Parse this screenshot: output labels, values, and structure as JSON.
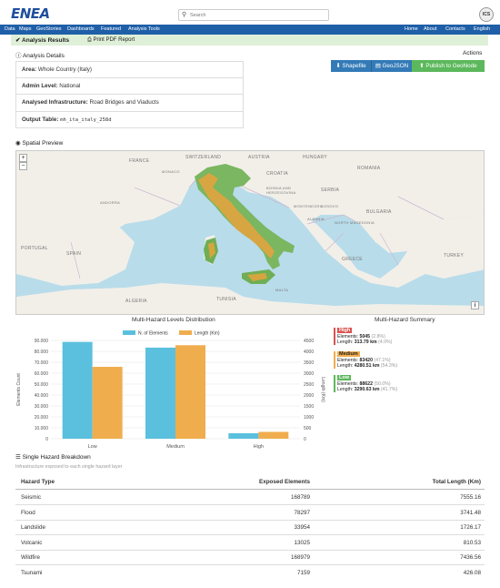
{
  "header": {
    "logo": "ENEA",
    "search_placeholder": "Search",
    "account_logo": "ICS"
  },
  "nav": {
    "left": [
      "Data",
      "Maps",
      "GeoStories",
      "Dashboards",
      "Featured",
      "Analysis Tools"
    ],
    "right": [
      "Home",
      "About",
      "Contacts",
      "English"
    ]
  },
  "results": {
    "title": "Analysis Results",
    "print": "Print PDF Report"
  },
  "details": {
    "heading": "Analysis Details",
    "actions_label": "Actions",
    "rows": [
      {
        "label": "Area:",
        "value": "Whole Country (Italy)"
      },
      {
        "label": "Admin Level:",
        "value": "National"
      },
      {
        "label": "Analysed Infrastructure:",
        "value": "Road Bridges and Viaducts"
      },
      {
        "label": "Output Table:",
        "value": "mh_ita_italy_258d"
      }
    ],
    "buttons": [
      "Shapefile",
      "GeoJSON",
      "Publish to GeoNode"
    ]
  },
  "map": {
    "heading": "Spatial Preview",
    "zoom_in": "+",
    "zoom_out": "−",
    "info": "i",
    "labels": [
      "FRANCE",
      "SWITZERLAND",
      "AUSTRIA",
      "HUNGARY",
      "ROMANIA",
      "CROATIA",
      "SERBIA",
      "MONACO",
      "BOSNIA AND HERZEGOVINA",
      "MONTENEGRO",
      "KOSOVO",
      "BULGARIA",
      "ANDORRA",
      "ALBANIA",
      "NORTH MACEDONIA",
      "PORTUGAL",
      "SPAIN",
      "GREECE",
      "TURKEY",
      "ALGERIA",
      "TUNISIA",
      "MALTA"
    ]
  },
  "chart": {
    "title": "Multi-Hazard Levels Distribution"
  },
  "chart_data": {
    "type": "bar",
    "title": "Multi-Hazard Levels Distribution",
    "categories": [
      "Low",
      "Medium",
      "High"
    ],
    "series": [
      {
        "name": "N. of Elements",
        "axis": "left",
        "color": "#5bc0de",
        "values": [
          88622,
          83420,
          5045
        ]
      },
      {
        "name": "Length (Km)",
        "axis": "right",
        "color": "#f0ad4e",
        "values": [
          3290.63,
          4280.51,
          313.79
        ]
      }
    ],
    "ylabel": "Elements Count",
    "y2label": "Length (Km)",
    "ylim": [
      0,
      90000
    ],
    "y2lim": [
      0,
      4500
    ],
    "yticks": [
      "0",
      "10.000",
      "20.000",
      "30.000",
      "40.000",
      "50.000",
      "60.000",
      "70.000",
      "80.000",
      "90.000"
    ],
    "y2ticks": [
      "0",
      "500",
      "1000",
      "1500",
      "2000",
      "2500",
      "3000",
      "3500",
      "4000",
      "4500"
    ],
    "legend": "top-center",
    "grid": true
  },
  "summary": {
    "title": "Multi-Hazard Summary",
    "items": [
      {
        "level": "High",
        "color": "#d9534f",
        "elements_label": "Elements:",
        "elements": "5045",
        "elements_pct": "(2.8%)",
        "length_label": "Length:",
        "length": "313.79 km",
        "length_pct": "(4.0%)"
      },
      {
        "level": "Medium",
        "color": "#f0ad4e",
        "elements_label": "Elements:",
        "elements": "83420",
        "elements_pct": "(47.1%)",
        "length_label": "Length:",
        "length": "4280.51 km",
        "length_pct": "(54.3%)"
      },
      {
        "level": "Low",
        "color": "#5cb85c",
        "elements_label": "Elements:",
        "elements": "88622",
        "elements_pct": "(50.0%)",
        "length_label": "Length:",
        "length": "3290.63 km",
        "length_pct": "(41.7%)"
      }
    ]
  },
  "breakdown": {
    "heading": "Single Hazard Breakdown",
    "subtitle": "Infrastructure exposed to each single hazard layer",
    "columns": [
      "Hazard Type",
      "Exposed Elements",
      "Total Length (Km)"
    ],
    "rows": [
      [
        "Seismic",
        "168789",
        "7555.16"
      ],
      [
        "Flood",
        "78297",
        "3741.48"
      ],
      [
        "Landslide",
        "33954",
        "1726.17"
      ],
      [
        "Volcanic",
        "13025",
        "810.53"
      ],
      [
        "Wildfire",
        "168979",
        "7436.56"
      ],
      [
        "Tsunami",
        "7159",
        "426.08"
      ]
    ]
  },
  "colors": {
    "nav": "#1f5fa8",
    "result_bg": "#dff0d8",
    "btn_primary": "#337ab7",
    "btn_success": "#5cb85c",
    "high": "#d9534f",
    "medium": "#f0ad4e",
    "low": "#5cb85c"
  }
}
